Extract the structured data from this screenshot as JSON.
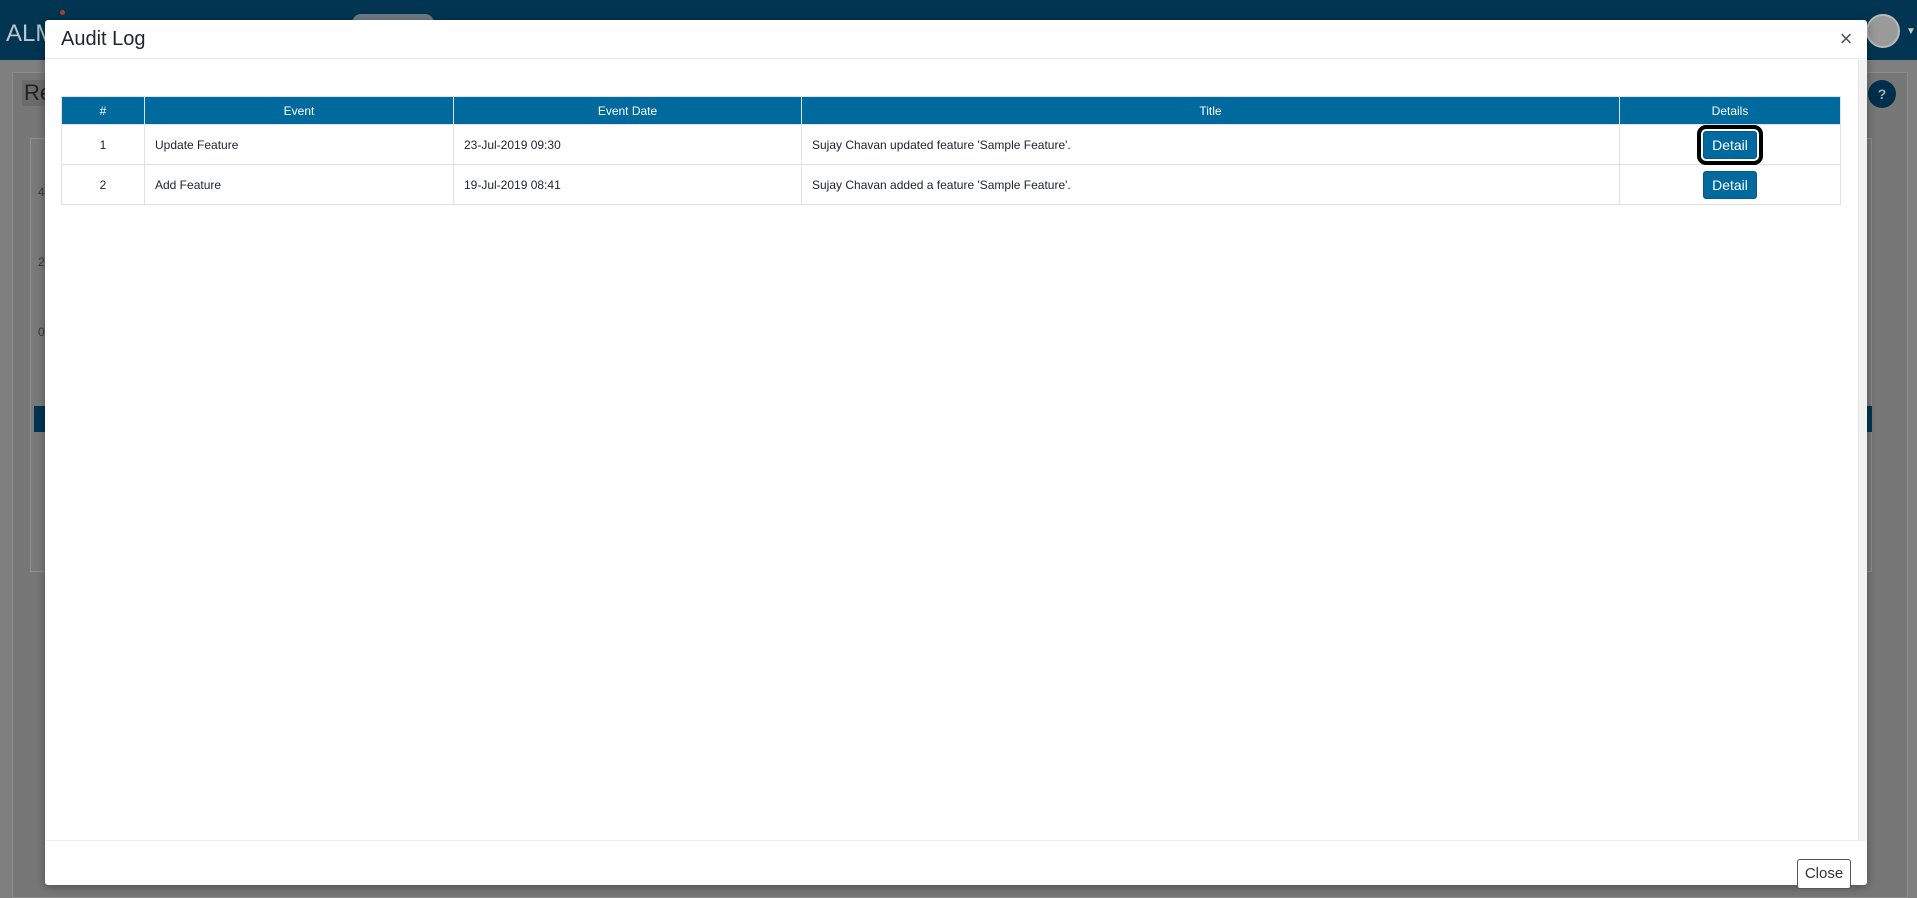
{
  "background_app": {
    "logo_text": "ALM",
    "heading_text": "Re",
    "help_icon": "question-circle-icon",
    "chart_ticks": [
      "4",
      "2",
      "0"
    ]
  },
  "modal": {
    "title": "Audit Log",
    "close_x": "×",
    "table": {
      "headers": [
        "#",
        "Event",
        "Event Date",
        "Title",
        "Details"
      ],
      "rows": [
        {
          "num": "1",
          "event": "Update Feature",
          "event_date": "23-Jul-2019 09:30",
          "title": "Sujay Chavan updated feature 'Sample Feature'.",
          "details_label": "Detail",
          "focused": true
        },
        {
          "num": "2",
          "event": "Add Feature",
          "event_date": "19-Jul-2019 08:41",
          "title": "Sujay Chavan added a feature 'Sample Feature'.",
          "details_label": "Detail",
          "focused": false
        }
      ]
    },
    "footer": {
      "close_label": "Close"
    }
  },
  "colors": {
    "nav_bar": "#013552",
    "table_header": "#006a9e",
    "detail_button": "#006a9e",
    "backdrop": "#7f7f7f"
  }
}
